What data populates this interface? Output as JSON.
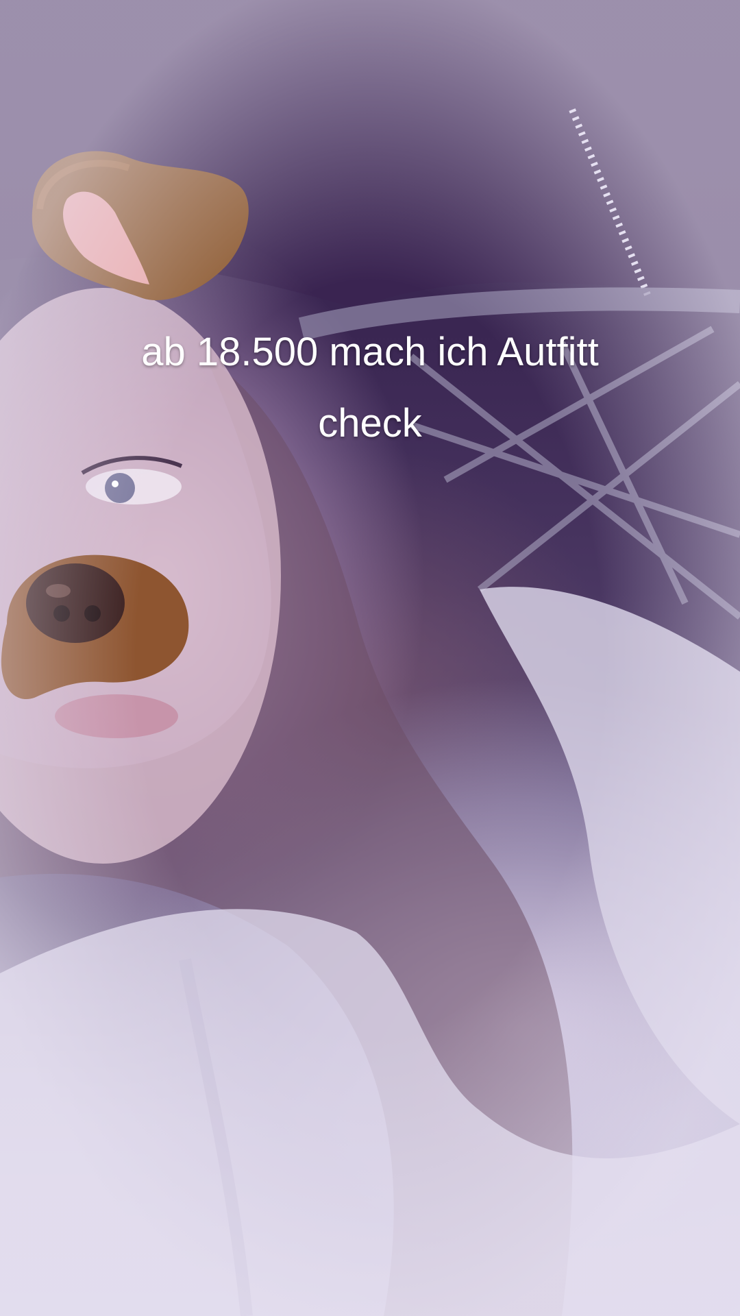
{
  "video": {
    "caption_line_1": "ab 18.500 mach ich Autfitt",
    "caption_line_2": "check"
  },
  "filter": {
    "ear_icon": "dog-ear-icon",
    "nose_icon": "dog-nose-icon"
  },
  "colors": {
    "caption_text": "#ffffff",
    "background": "#3e2a55",
    "filter_brown": "#8a5528"
  }
}
